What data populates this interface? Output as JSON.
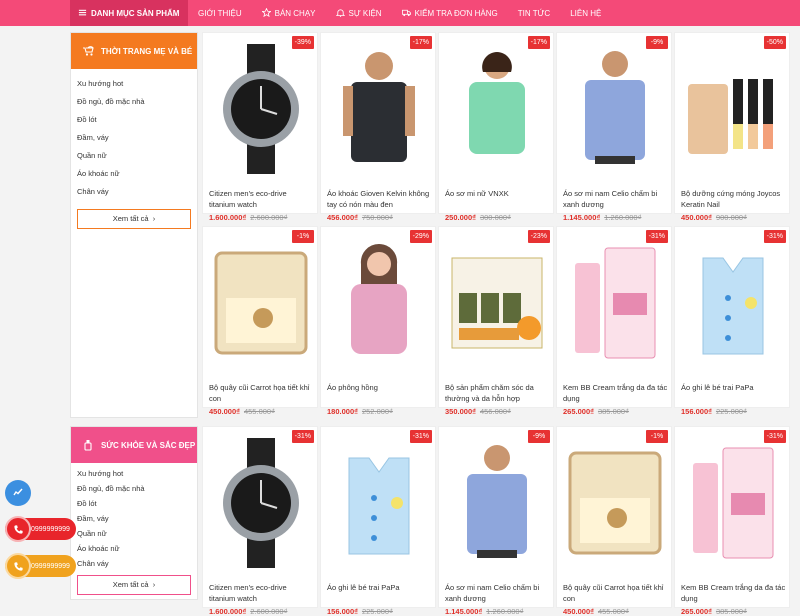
{
  "nav": {
    "category_menu": "DANH MỤC SẢN PHẨM",
    "items": [
      "GIỚI THIỆU",
      "BÁN CHẠY",
      "SỰ KIỆN",
      "KIỂM TRA ĐƠN HÀNG",
      "TIN TỨC",
      "LIÊN HỆ"
    ]
  },
  "colors": {
    "brand": "#f44a78",
    "section1": "#f47a20",
    "section2": "#f0508a",
    "sale_badge": "#e73233",
    "price": "#e0302a"
  },
  "sections": [
    {
      "title": "THỜI TRANG MẸ VÀ BÉ",
      "icon": "stroller-icon",
      "links": [
        "Xu hướng hot",
        "Đồ ngủ, đồ mặc nhà",
        "Đồ lót",
        "Đầm, váy",
        "Quần nữ",
        "Áo khoác nữ",
        "Chân váy"
      ],
      "see_all": "Xem tất cả",
      "products": [
        {
          "name": "Citizen men's eco-drive titanium watch",
          "price": "1.600.000₫",
          "old_price": "2.600.000₫",
          "discount": "-39%",
          "thumb": "watch"
        },
        {
          "name": "Áo khoác Gioven Kelvin không tay có nón màu đen",
          "price": "456.000₫",
          "old_price": "750.000₫",
          "discount": "-17%",
          "thumb": "vest"
        },
        {
          "name": "Áo sơ mi nữ VNXK",
          "price": "250.000₫",
          "old_price": "300.000₫",
          "discount": "-17%",
          "thumb": "greenshirt"
        },
        {
          "name": "Áo sơ mi nam Celio chấm bi xanh dương",
          "price": "1.145.000₫",
          "old_price": "1.260.000₫",
          "discount": "-9%",
          "thumb": "blueshirt"
        },
        {
          "name": "Bộ dưỡng cứng móng Joycos Keratin Nail",
          "price": "450.000₫",
          "old_price": "900.000₫",
          "discount": "-50%",
          "thumb": "nails"
        },
        {
          "name": "Bộ quây cũi Carrot họa tiết khỉ con",
          "price": "450.000₫",
          "old_price": "455.000₫",
          "discount": "-1%",
          "thumb": "crib"
        },
        {
          "name": "Áo phông hồng",
          "price": "180.000₫",
          "old_price": "252.000₫",
          "discount": "-29%",
          "thumb": "pinkgirl"
        },
        {
          "name": "Bộ sản phẩm chăm sóc da thường và da hỗn hợp",
          "price": "350.000₫",
          "old_price": "456.000₫",
          "discount": "-23%",
          "thumb": "skincare"
        },
        {
          "name": "Kem BB Cream trắng da đa tác dụng",
          "price": "265.000₫",
          "old_price": "385.000₫",
          "discount": "-31%",
          "thumb": "bbcream"
        },
        {
          "name": "Áo ghi lê bé trai PaPa",
          "price": "156.000₫",
          "old_price": "225.000₫",
          "discount": "-31%",
          "thumb": "babyvest"
        }
      ]
    },
    {
      "title": "SỨC KHỎE VÀ SẮC ĐẸP",
      "icon": "beauty-icon",
      "links": [
        "Xu hướng hot",
        "Đồ ngủ, đồ mặc nhà",
        "Đồ lót",
        "Đầm, váy",
        "Quần nữ",
        "Áo khoác nữ",
        "Chân váy"
      ],
      "see_all": "Xem tất cả",
      "products": [
        {
          "name": "Citizen men's eco-drive titanium watch",
          "price": "1.600.000₫",
          "old_price": "2.600.000₫",
          "discount": "-31%",
          "thumb": "watch"
        },
        {
          "name": "Áo ghi lê bé trai PaPa",
          "price": "156.000₫",
          "old_price": "225.000₫",
          "discount": "-31%",
          "thumb": "babyvest"
        },
        {
          "name": "Áo sơ mi nam Celio chấm bi xanh dương",
          "price": "1.145.000₫",
          "old_price": "1.260.000₫",
          "discount": "-9%",
          "thumb": "blueshirt"
        },
        {
          "name": "Bộ quây cũi Carrot họa tiết khỉ con",
          "price": "450.000₫",
          "old_price": "455.000₫",
          "discount": "-1%",
          "thumb": "crib"
        },
        {
          "name": "Kem BB Cream trắng da đa tác dụng",
          "price": "265.000₫",
          "old_price": "385.000₫",
          "discount": "-31%",
          "thumb": "bbcream"
        }
      ]
    }
  ],
  "contact": {
    "phone1": "0999999999",
    "phone2": "0999999999"
  }
}
